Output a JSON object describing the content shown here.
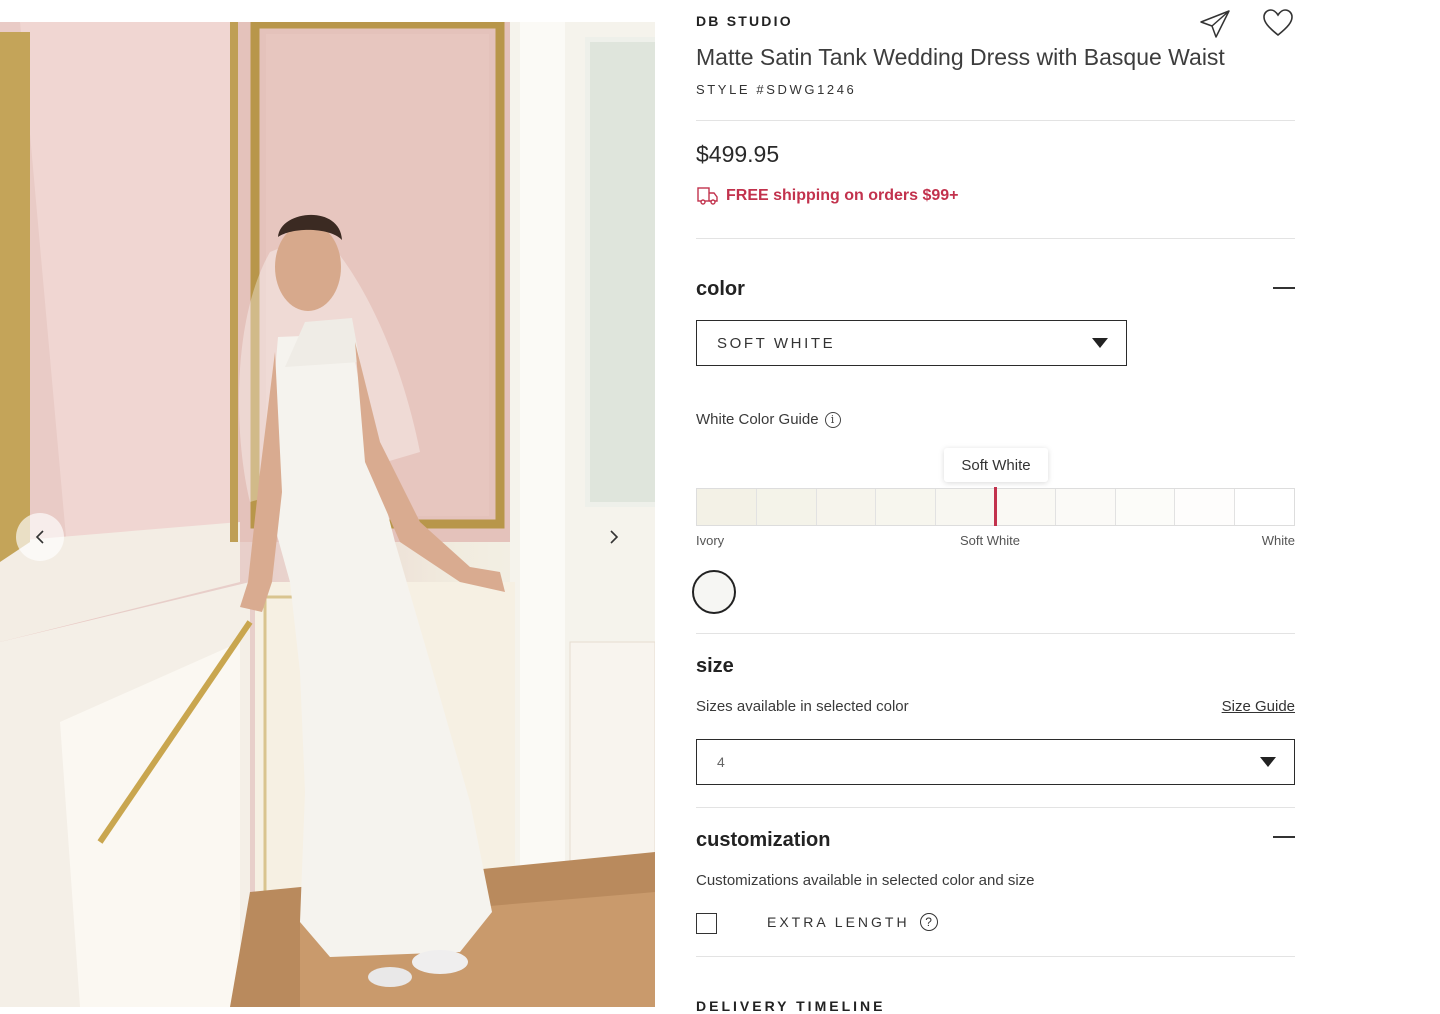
{
  "product": {
    "brand": "DB STUDIO",
    "title": "Matte Satin Tank Wedding Dress with Basque Waist",
    "style_number": "STYLE #SDWG1246",
    "price": "$499.95",
    "shipping_text": "FREE shipping on orders $99+"
  },
  "color_section": {
    "title": "color",
    "selected_value": "SOFT WHITE",
    "guide_label": "White Color Guide",
    "tooltip": "Soft White",
    "scale_labels": {
      "left": "Ivory",
      "middle": "Soft White",
      "right": "White"
    },
    "swatch_count": 10,
    "selected_index": 4
  },
  "size_section": {
    "title": "size",
    "subtitle": "Sizes available in selected color",
    "size_guide_link": "Size Guide",
    "selected_value": "4"
  },
  "customization_section": {
    "title": "customization",
    "subtitle": "Customizations available in selected color and size",
    "option_label": "EXTRA LENGTH",
    "option_checked": false
  },
  "next_section_partial": "DELIVERY TIMELINE",
  "colors": {
    "accent": "#c2324d",
    "swatch_fill": "#f6f6f3",
    "ivory": "#f3f1e6",
    "white": "#ffffff"
  },
  "icons": {
    "share": "paper-plane-icon",
    "favorite": "heart-icon",
    "prev": "chevron-left-icon",
    "next": "chevron-right-icon",
    "shipping": "truck-icon",
    "info": "info-icon",
    "help": "question-icon",
    "collapse": "minus-icon",
    "dropdown": "caret-down-icon"
  }
}
